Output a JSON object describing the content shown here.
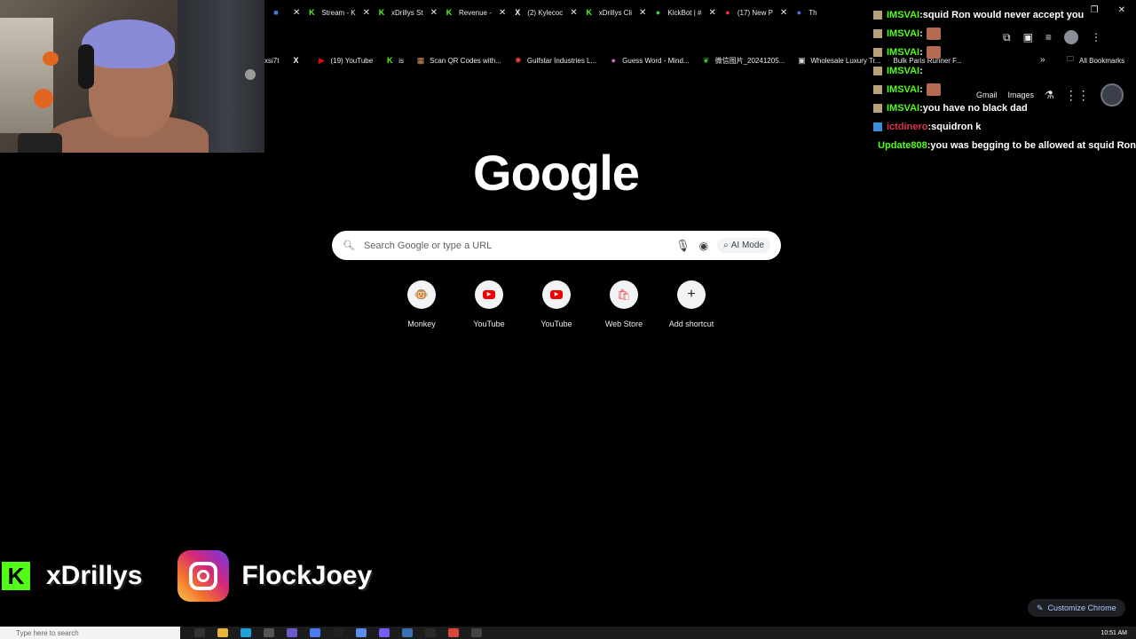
{
  "tabs": [
    {
      "label": "",
      "favicon": "blue-square-icon",
      "color": "#3d7dd8"
    },
    {
      "label": "Stream - K",
      "favicon": "kick-icon"
    },
    {
      "label": "xDrillys St",
      "favicon": "kick-icon"
    },
    {
      "label": "Revenue -",
      "favicon": "kick-icon"
    },
    {
      "label": "(2) Kylecoc",
      "favicon": "x-icon"
    },
    {
      "label": "xDrillys Cli",
      "favicon": "kick-icon"
    },
    {
      "label": "KickBot | #",
      "favicon": "green-bot-icon"
    },
    {
      "label": "(17) New P",
      "favicon": "red-icon"
    },
    {
      "label": "Th",
      "favicon": "blue-circle-icon"
    }
  ],
  "bookmarks": [
    {
      "label": "xsi7t",
      "icon": ""
    },
    {
      "label": "",
      "icon": "x-icon"
    },
    {
      "label": "(19) YouTube",
      "icon": "youtube-icon"
    },
    {
      "label": "is",
      "icon": "kick-icon"
    },
    {
      "label": "Scan QR Codes with...",
      "icon": "qr-icon"
    },
    {
      "label": "Gulfstar Industries L...",
      "icon": "gear-icon"
    },
    {
      "label": "Guess Word - Mind...",
      "icon": "circle-icon"
    },
    {
      "label": "微信图片_20241205...",
      "icon": "leaf-icon"
    },
    {
      "label": "Wholesale Luxury Tr...",
      "icon": "image-icon"
    },
    {
      "label": "Bulk Paris Runner F...",
      "icon": ""
    }
  ],
  "bookmarks_all": "All Bookmarks",
  "ntp": {
    "gmail": "Gmail",
    "images": "Images",
    "logo": "Google",
    "search_placeholder": "Search Google or type a URL",
    "ai_mode": "AI Mode",
    "customize": "Customize Chrome"
  },
  "shortcuts": [
    {
      "label": "Monkey",
      "icon": "monkey-icon"
    },
    {
      "label": "YouTube",
      "icon": "youtube-icon"
    },
    {
      "label": "YouTube",
      "icon": "youtube-icon"
    },
    {
      "label": "Web Store",
      "icon": "webstore-icon"
    },
    {
      "label": "Add shortcut",
      "icon": "plus-icon"
    }
  ],
  "chat": [
    {
      "user": "IMSVAI",
      "sep": " : ",
      "message": "squid Ron would never accept you",
      "emote": false,
      "user_color": "#53fc18"
    },
    {
      "user": "IMSVAI",
      "sep": " : ",
      "message": "",
      "emote": true,
      "user_color": "#53fc18"
    },
    {
      "user": "IMSVAI",
      "sep": " : ",
      "message": "",
      "emote": true,
      "user_color": "#53fc18"
    },
    {
      "user": "IMSVAI",
      "sep": " : ",
      "message": "",
      "emote": false,
      "user_color": "#53fc18"
    },
    {
      "user": "IMSVAI",
      "sep": " : ",
      "message": "",
      "emote": true,
      "user_color": "#53fc18"
    },
    {
      "user": "IMSVAI",
      "sep": " : ",
      "message": "you have no black dad",
      "emote": false,
      "user_color": "#53fc18"
    },
    {
      "user": "ictdinero",
      "sep": " : ",
      "message": "squidron k",
      "emote": false,
      "user_color": "#e0314b"
    },
    {
      "user": "Update808",
      "sep": " : ",
      "message": "you was begging to be allowed at squid Ron",
      "emote": false,
      "user_color": "#53fc18"
    }
  ],
  "socials": {
    "kick_name": "xDrillys",
    "instagram_name": "FlockJoey"
  },
  "taskbar": {
    "search_placeholder": "Type here to search",
    "time": "10:51 AM"
  },
  "colors": {
    "kick_green": "#53fc18",
    "background": "#000000",
    "search_bg": "#ffffff"
  }
}
